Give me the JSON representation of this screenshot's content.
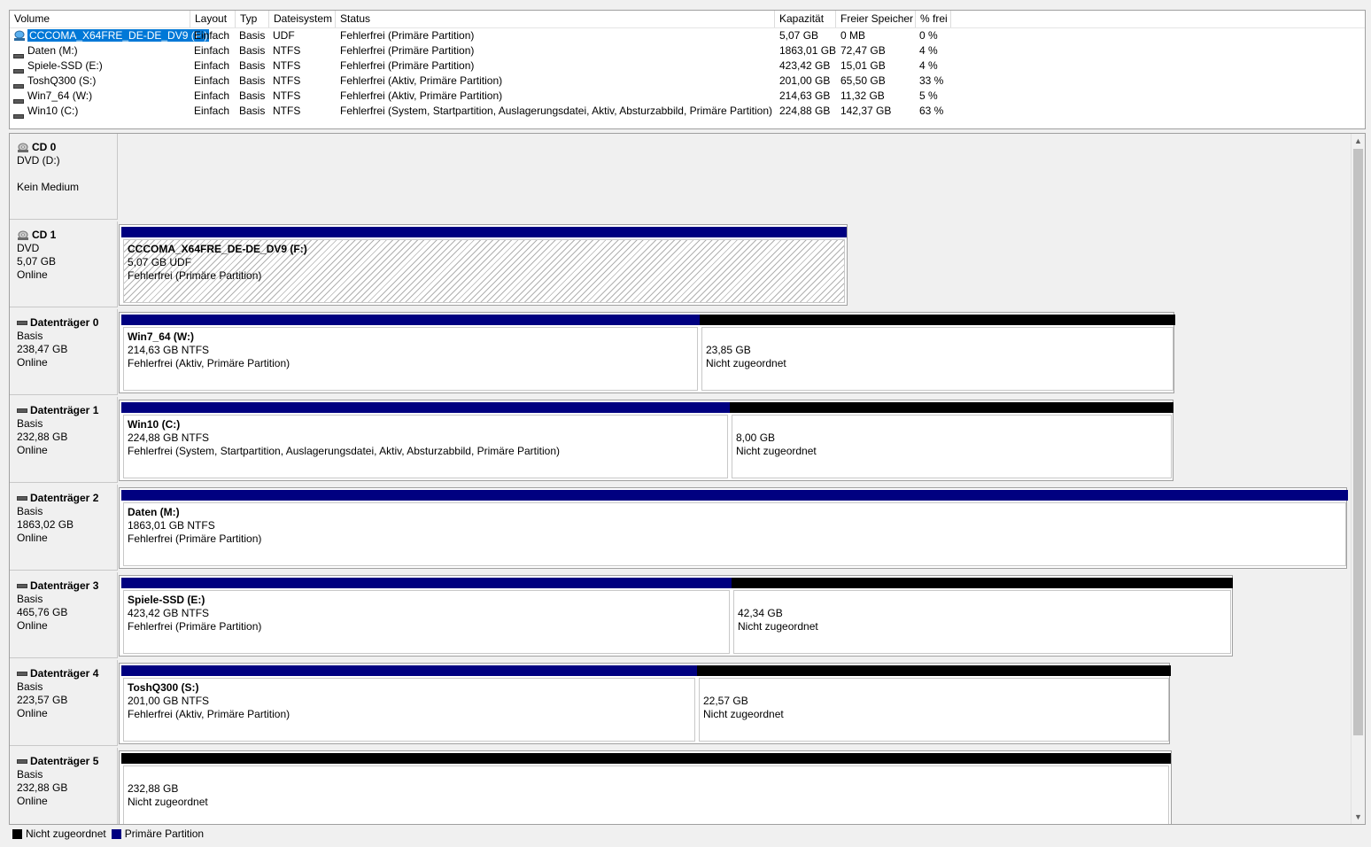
{
  "columns": [
    "Volume",
    "Layout",
    "Typ",
    "Dateisystem",
    "Status",
    "Kapazität",
    "Freier Speicher",
    "% frei"
  ],
  "volumes": [
    {
      "name": "CCCOMA_X64FRE_DE-DE_DV9 (F:)",
      "layout": "Einfach",
      "typ": "Basis",
      "fs": "UDF",
      "status": "Fehlerfrei (Primäre Partition)",
      "cap": "5,07 GB",
      "free": "0 MB",
      "pct": "0 %",
      "icon": "cd-drive-icon"
    },
    {
      "name": "Daten (M:)",
      "layout": "Einfach",
      "typ": "Basis",
      "fs": "NTFS",
      "status": "Fehlerfrei (Primäre Partition)",
      "cap": "1863,01 GB",
      "free": "72,47 GB",
      "pct": "4 %",
      "icon": "drive-icon"
    },
    {
      "name": "Spiele-SSD (E:)",
      "layout": "Einfach",
      "typ": "Basis",
      "fs": "NTFS",
      "status": "Fehlerfrei (Primäre Partition)",
      "cap": "423,42 GB",
      "free": "15,01 GB",
      "pct": "4 %",
      "icon": "drive-icon"
    },
    {
      "name": "ToshQ300 (S:)",
      "layout": "Einfach",
      "typ": "Basis",
      "fs": "NTFS",
      "status": "Fehlerfrei (Aktiv, Primäre Partition)",
      "cap": "201,00 GB",
      "free": "65,50 GB",
      "pct": "33 %",
      "icon": "drive-icon"
    },
    {
      "name": "Win7_64 (W:)",
      "layout": "Einfach",
      "typ": "Basis",
      "fs": "NTFS",
      "status": "Fehlerfrei (Aktiv, Primäre Partition)",
      "cap": "214,63 GB",
      "free": "11,32 GB",
      "pct": "5 %",
      "icon": "drive-icon"
    },
    {
      "name": "Win10 (C:)",
      "layout": "Einfach",
      "typ": "Basis",
      "fs": "NTFS",
      "status": "Fehlerfrei (System, Startpartition, Auslagerungsdatei, Aktiv, Absturzabbild, Primäre Partition)",
      "cap": "224,88 GB",
      "free": "142,37 GB",
      "pct": "63 %",
      "icon": "drive-icon"
    }
  ],
  "disks": [
    {
      "name": "CD 0",
      "lines": [
        "DVD (D:)",
        "",
        "Kein Medium"
      ],
      "icon": "cd-drive-icon",
      "partitions": []
    },
    {
      "name": "CD 1",
      "lines": [
        "DVD",
        "5,07 GB",
        "Online"
      ],
      "icon": "cd-drive-icon",
      "partitions": [
        {
          "kind": "primary",
          "hatched": true,
          "title": "CCCOMA_X64FRE_DE-DE_DV9  (F:)",
          "l1": "5,07 GB UDF",
          "l2": "Fehlerfrei (Primäre Partition)"
        }
      ]
    },
    {
      "name": "Datenträger 0",
      "lines": [
        "Basis",
        "238,47 GB",
        "Online"
      ],
      "icon": "disk-icon",
      "partitions": [
        {
          "kind": "primary",
          "title": "Win7_64  (W:)",
          "l1": "214,63 GB NTFS",
          "l2": "Fehlerfrei (Aktiv, Primäre Partition)"
        },
        {
          "kind": "unalloc",
          "title": "",
          "l1": "23,85 GB",
          "l2": "Nicht zugeordnet"
        }
      ]
    },
    {
      "name": "Datenträger 1",
      "lines": [
        "Basis",
        "232,88 GB",
        "Online"
      ],
      "icon": "disk-icon",
      "partitions": [
        {
          "kind": "primary",
          "title": "Win10  (C:)",
          "l1": "224,88 GB NTFS",
          "l2": "Fehlerfrei (System, Startpartition, Auslagerungsdatei, Aktiv, Absturzabbild, Primäre Partition)"
        },
        {
          "kind": "unalloc",
          "title": "",
          "l1": "8,00 GB",
          "l2": "Nicht zugeordnet"
        }
      ]
    },
    {
      "name": "Datenträger 2",
      "lines": [
        "Basis",
        "1863,02 GB",
        "Online"
      ],
      "icon": "disk-icon",
      "partitions": [
        {
          "kind": "primary",
          "title": "Daten  (M:)",
          "l1": "1863,01 GB NTFS",
          "l2": "Fehlerfrei (Primäre Partition)"
        }
      ]
    },
    {
      "name": "Datenträger 3",
      "lines": [
        "Basis",
        "465,76 GB",
        "Online"
      ],
      "icon": "disk-icon",
      "partitions": [
        {
          "kind": "primary",
          "title": "Spiele-SSD  (E:)",
          "l1": "423,42 GB NTFS",
          "l2": "Fehlerfrei (Primäre Partition)"
        },
        {
          "kind": "unalloc",
          "title": "",
          "l1": "42,34 GB",
          "l2": "Nicht zugeordnet"
        }
      ]
    },
    {
      "name": "Datenträger 4",
      "lines": [
        "Basis",
        "223,57 GB",
        "Online"
      ],
      "icon": "disk-icon",
      "partitions": [
        {
          "kind": "primary",
          "title": "ToshQ300  (S:)",
          "l1": "201,00 GB NTFS",
          "l2": "Fehlerfrei (Aktiv, Primäre Partition)"
        },
        {
          "kind": "unalloc",
          "title": "",
          "l1": "22,57 GB",
          "l2": "Nicht zugeordnet"
        }
      ]
    },
    {
      "name": "Datenträger 5",
      "lines": [
        "Basis",
        "232,88 GB",
        "Online"
      ],
      "icon": "disk-icon",
      "partitions": [
        {
          "kind": "unalloc",
          "title": "",
          "l1": "232,88 GB",
          "l2": "Nicht zugeordnet"
        }
      ]
    }
  ],
  "legend": [
    {
      "label": "Nicht zugeordnet",
      "color": "#000000"
    },
    {
      "label": "Primäre Partition",
      "color": "#000080"
    }
  ],
  "colors": {
    "primary": "#000080",
    "unallocated": "#000000",
    "selection": "#0078d7"
  }
}
